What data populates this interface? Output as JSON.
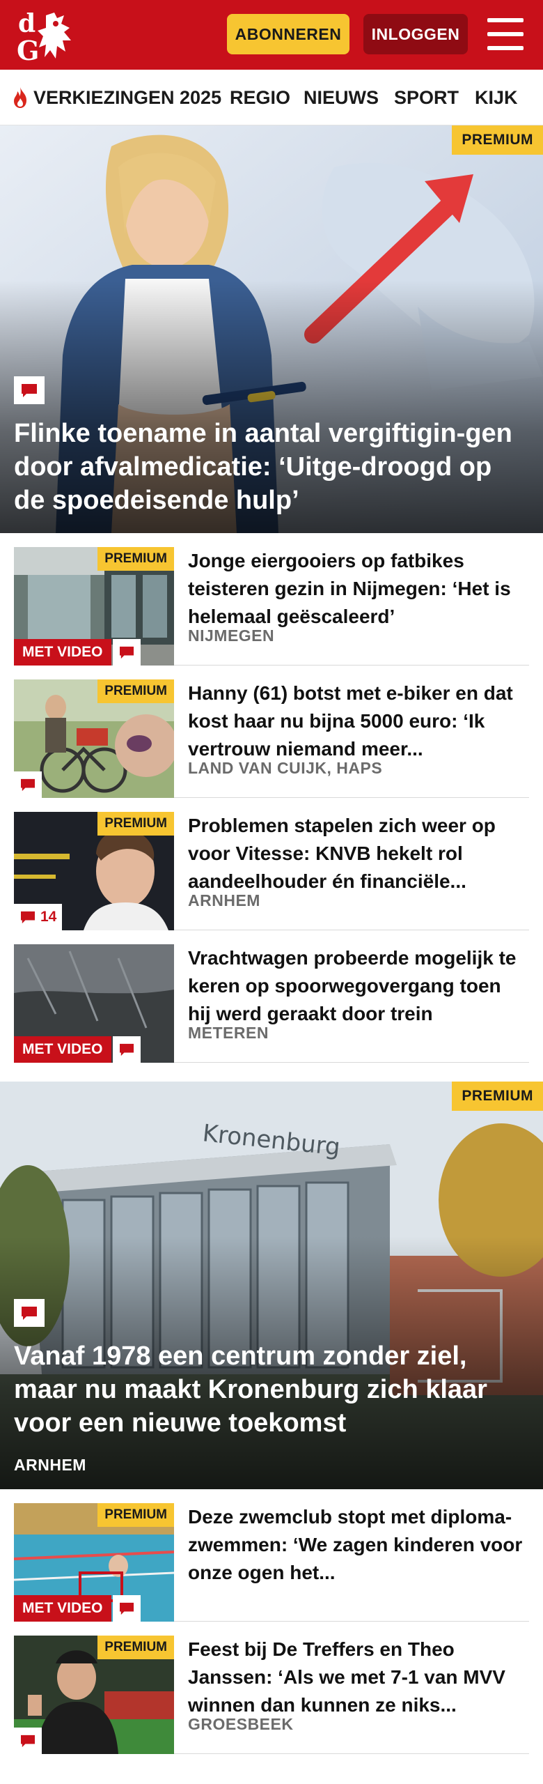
{
  "header": {
    "logo_text": "dG",
    "subscribe_label": "ABONNEREN",
    "login_label": "INLOGGEN",
    "brand_color": "#c8101a",
    "accent_color": "#f7c531"
  },
  "nav": {
    "items": [
      {
        "label": "VERKIEZINGEN 2025",
        "icon": "flame-icon"
      },
      {
        "label": "REGIO"
      },
      {
        "label": "NIEUWS"
      },
      {
        "label": "SPORT"
      },
      {
        "label": "KIJK"
      }
    ]
  },
  "hero1": {
    "premium_label": "PREMIUM",
    "title": "Flinke toename in aantal vergiftigin-gen door afvalmedicatie: ‘Uitge-droogd op de spoedeisende hulp’",
    "comment_icon": "comment-icon"
  },
  "articles": [
    {
      "title": "Jonge eiergooiers op fatbikes teisteren gezin in Nijmegen: ‘Het is helemaal geëscaleerd’",
      "location": "NIJMEGEN",
      "premium": "PREMIUM",
      "video": "MET VIDEO",
      "comments": ""
    },
    {
      "title": "Hanny (61) botst met e-biker en dat kost haar nu bijna 5000 euro: ‘Ik vertrouw niemand meer...",
      "location": "LAND VAN CUIJK, HAPS",
      "premium": "PREMIUM",
      "video": "",
      "comments": ""
    },
    {
      "title": "Problemen stapelen zich weer op voor Vitesse: KNVB hekelt rol aandeelhouder én financiële...",
      "location": "ARNHEM",
      "premium": "PREMIUM",
      "video": "",
      "comments": "14"
    },
    {
      "title": "Vrachtwagen probeerde mogelijk te keren op spoorwegovergang toen hij werd geraakt door trein",
      "location": "METEREN",
      "premium": "",
      "video": "MET VIDEO",
      "comments": ""
    }
  ],
  "hero2": {
    "premium_label": "PREMIUM",
    "title": "Vanaf 1978 een centrum zonder ziel, maar nu maakt Kronenburg zich klaar voor een nieuwe toekomst",
    "location": "ARNHEM",
    "building_sign": "Kronenburg"
  },
  "articles2": [
    {
      "title": "Deze zwemclub stopt met diploma-zwemmen: ‘We zagen kinderen voor onze ogen het...",
      "location": "",
      "premium": "PREMIUM",
      "video": "MET VIDEO",
      "comments": ""
    },
    {
      "title": "Feest bij De Treffers en Theo Janssen: ‘Als we met 7-1 van MVV winnen dan kunnen ze niks...",
      "location": "GROESBEEK",
      "premium": "PREMIUM",
      "video": "",
      "comments": ""
    }
  ]
}
